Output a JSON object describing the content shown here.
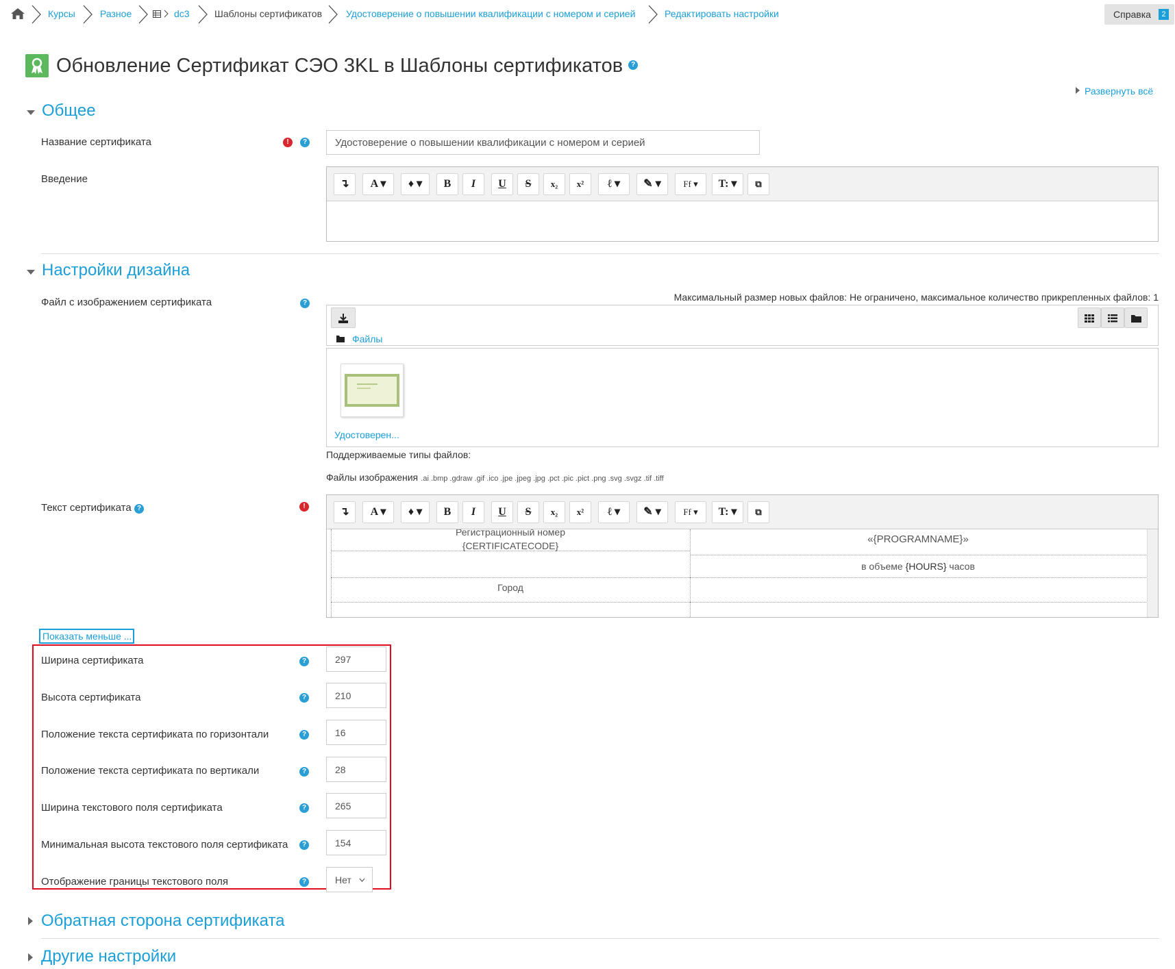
{
  "breadcrumb": {
    "home_icon": "home-icon",
    "items": [
      {
        "label": "Курсы",
        "link": true
      },
      {
        "label": "Разное",
        "link": true
      },
      {
        "label": "dc3",
        "link": true
      },
      {
        "label": "Шаблоны сертификатов",
        "link": false
      },
      {
        "label": "Удостоверение о повышении квалификации с номером и серией",
        "link": true
      },
      {
        "label": "Редактировать настройки",
        "link": true
      }
    ]
  },
  "help": {
    "label": "Справка",
    "badge": "2"
  },
  "page": {
    "title": "Обновление Сертификат СЭО 3KL в Шаблоны сертификатов",
    "expand_all": "Развернуть всё"
  },
  "sections": {
    "general": "Общее",
    "design": "Настройки дизайна",
    "back": "Обратная сторона сертификата",
    "other": "Другие настройки"
  },
  "general": {
    "name_label": "Название сертификата",
    "name_value": "Удостоверение о повышении квалификации с номером и серией",
    "intro_label": "Введение"
  },
  "toolbar": {
    "buttons": [
      "↴",
      "A",
      "♦",
      "B",
      "I",
      "U",
      "S",
      "x₂",
      "x²",
      "ℓ",
      "✎",
      "Ff",
      "T:",
      "⧉"
    ]
  },
  "design": {
    "file_label": "Файл с изображением сертификата",
    "max_size": "Максимальный размер новых файлов: Не ограничено, максимальное количество прикрепленных файлов: 1",
    "files_link": "Файлы",
    "file_name": "Удостоверен...",
    "supported_types": "Поддерживаемые типы файлов:",
    "image_files_label": "Файлы изображения",
    "image_extensions": ".ai .bmp .gdraw .gif .ico .jpe .jpeg .jpg .pct .pic .pict .png .svg .svgz .tif .tiff",
    "text_label": "Текст сертификата",
    "text_cells": {
      "reg_line1": "Регистрационный номер",
      "reg_line2": "{CERTIFICATECODE}",
      "program": "«{PROGRAMNAME}»",
      "hours_prefix": "в объеме",
      "hours_tag": "{HOURS}",
      "hours_suffix": "часов",
      "city": "Город"
    },
    "show_less": "Показать меньше ..."
  },
  "fields": [
    {
      "label": "Ширина сертификата",
      "value": "297"
    },
    {
      "label": "Высота сертификата",
      "value": "210"
    },
    {
      "label": "Положение текста сертификата по горизонтали",
      "value": "16"
    },
    {
      "label": "Положение текста сертификата по вертикали",
      "value": "28"
    },
    {
      "label": "Ширина текстового поля сертификата",
      "value": "265"
    },
    {
      "label": "Минимальная высота текстового поля сертификата",
      "value": "154"
    }
  ],
  "border_field": {
    "label": "Отображение границы текстового поля",
    "value": "Нет"
  }
}
